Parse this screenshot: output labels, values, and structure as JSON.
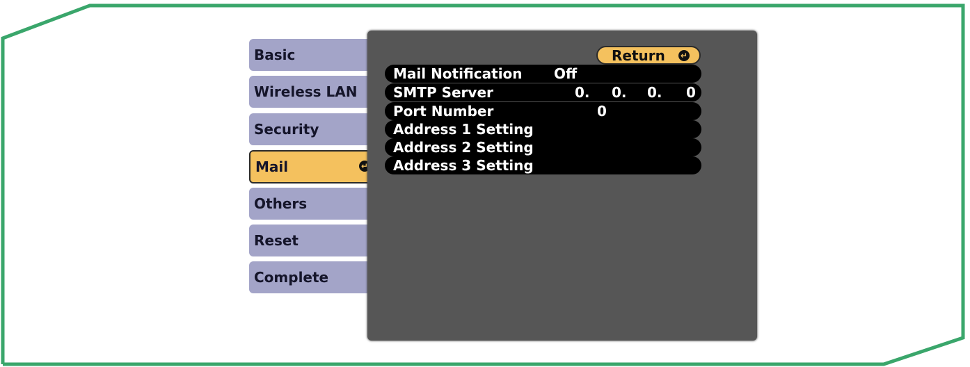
{
  "colors": {
    "frame": "#3aa66b",
    "tab_inactive": "#a3a4c8",
    "tab_active": "#f4c15e",
    "panel": "#565656",
    "row": "#000000"
  },
  "menu": {
    "tabs": [
      {
        "label": "Basic"
      },
      {
        "label": "Wireless LAN"
      },
      {
        "label": "Security"
      },
      {
        "label": "Mail"
      },
      {
        "label": "Others"
      },
      {
        "label": "Reset"
      },
      {
        "label": "Complete"
      }
    ],
    "active_tab": "Mail",
    "enter_icon": "enter-icon"
  },
  "panel": {
    "return_label": "Return",
    "rows": [
      {
        "label": "Mail Notification",
        "value": "Off"
      },
      {
        "label": "SMTP Server",
        "value_parts": [
          "0.",
          "0.",
          "0.",
          "0"
        ]
      },
      {
        "label": "Port Number",
        "value": "0"
      },
      {
        "label": "Address 1 Setting"
      },
      {
        "label": "Address 2 Setting"
      },
      {
        "label": "Address 3 Setting"
      }
    ]
  }
}
